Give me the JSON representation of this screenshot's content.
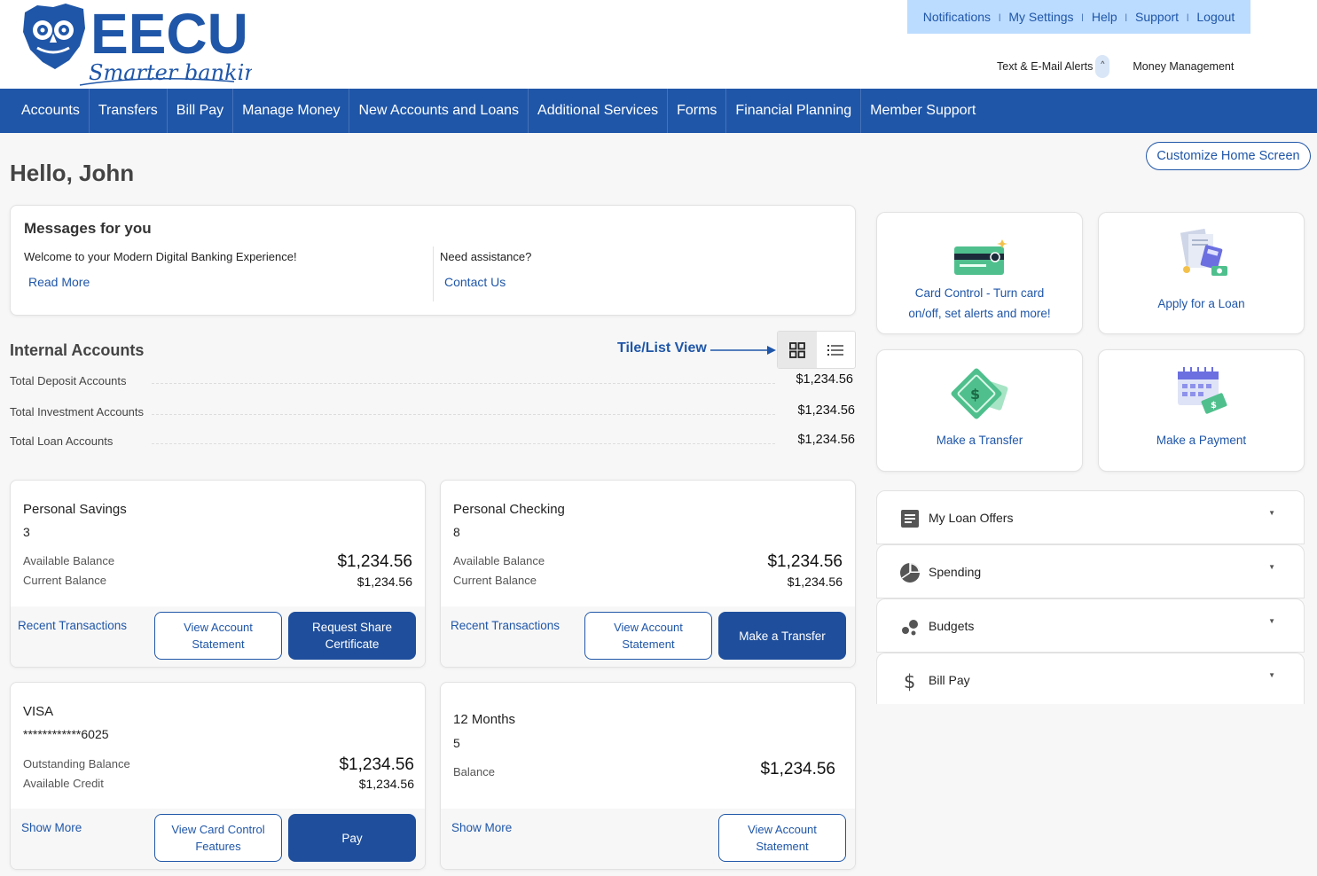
{
  "brand": {
    "name": "EECU",
    "tagline": "Smarter banking"
  },
  "top_links": [
    "Notifications",
    "My Settings",
    "Help",
    "Support",
    "Logout"
  ],
  "sub_links": {
    "alerts": "Text & E-Mail Alerts",
    "alerts_toggle": "^",
    "money": "Money Management"
  },
  "nav": [
    "Accounts",
    "Transfers",
    "Bill Pay",
    "Manage Money",
    "New Accounts and Loans",
    "Additional Services",
    "Forms",
    "Financial Planning",
    "Member Support"
  ],
  "greeting": "Hello, John",
  "customize_label": "Customize Home Screen",
  "messages": {
    "title": "Messages for you",
    "left_text": "Welcome to your Modern Digital Banking Experience!",
    "left_link": "Read More",
    "right_text": "Need assistance?",
    "right_link": "Contact Us"
  },
  "internal": {
    "title": "Internal Accounts",
    "tile_list_label": "Tile/List View",
    "rows": [
      {
        "label": "Total Deposit Accounts",
        "amount": "$1,234.56"
      },
      {
        "label": "Total Investment Accounts",
        "amount": "$1,234.56"
      },
      {
        "label": "Total Loan Accounts",
        "amount": "$1,234.56"
      }
    ]
  },
  "cards": {
    "savings": {
      "name": "Personal Savings",
      "number": "3",
      "l1": "Available Balance",
      "v1": "$1,234.56",
      "l2": "Current Balance",
      "v2": "$1,234.56",
      "link": "Recent Transactions",
      "btn1": "View Account Statement",
      "btn2": "Request Share Certificate"
    },
    "checking": {
      "name": "Personal Checking",
      "number": "8",
      "l1": "Available Balance",
      "v1": "$1,234.56",
      "l2": "Current Balance",
      "v2": "$1,234.56",
      "link": "Recent Transactions",
      "btn1": "View Account Statement",
      "btn2": "Make a Transfer"
    },
    "visa": {
      "name": "VISA",
      "number": "************6025",
      "l1": "Outstanding Balance",
      "v1": "$1,234.56",
      "l2": "Available Credit",
      "v2": "$1,234.56",
      "link": "Show More",
      "btn1": "View Card Control Features",
      "btn2": "Pay"
    },
    "months": {
      "name": "12 Months",
      "number": "5",
      "l1": "Balance",
      "v1": "$1,234.56",
      "link": "Show More",
      "btn1": "View Account Statement"
    }
  },
  "quick_tiles": [
    {
      "label1": "Card Control - Turn card",
      "label2": "on/off, set alerts and more!",
      "icon": "credit-card-icon"
    },
    {
      "label1": "Apply for a Loan",
      "icon": "loan-document-icon"
    },
    {
      "label1": "Make a Transfer",
      "icon": "money-transfer-icon"
    },
    {
      "label1": "Make a Payment",
      "icon": "calendar-payment-icon"
    }
  ],
  "widgets": [
    {
      "label": "My Loan Offers",
      "icon": "document-list-icon"
    },
    {
      "label": "Spending",
      "icon": "pie-chart-icon"
    },
    {
      "label": "Budgets",
      "icon": "dots-icon"
    },
    {
      "label": "Bill Pay",
      "icon": "dollar-icon"
    }
  ],
  "colors": {
    "brand_blue": "#1f56a8",
    "top_links_bg": "#bcdcff",
    "button_blue": "#1f4f9c",
    "green_icon": "#4fc08d"
  }
}
